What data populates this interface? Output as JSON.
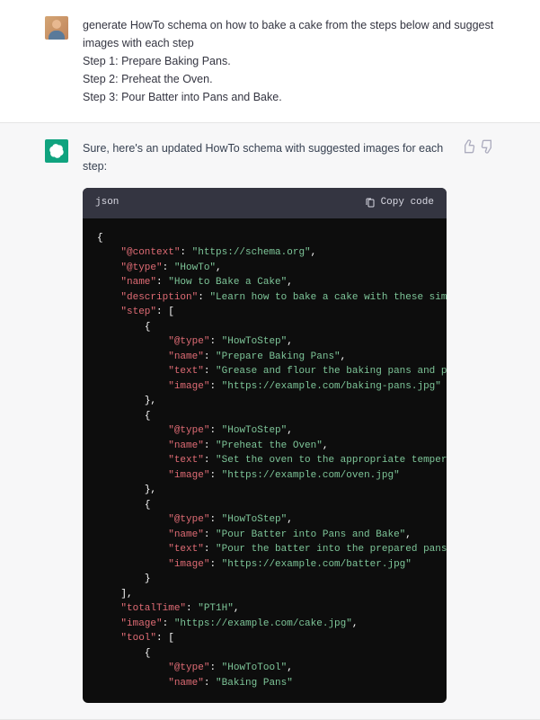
{
  "user": {
    "lines": [
      "generate HowTo schema on how to bake a cake from the steps below and suggest images with each step",
      "Step 1: Prepare Baking Pans.",
      "Step 2: Preheat the Oven.",
      "Step 3: Pour Batter into Pans and Bake."
    ]
  },
  "assistant": {
    "intro": "Sure, here's an updated HowTo schema with suggested images for each step:",
    "code_lang": "json",
    "copy_label": "Copy code"
  },
  "code": {
    "context_k": "\"@context\"",
    "context_v": "\"https://schema.org\"",
    "type_k": "\"@type\"",
    "howto_v": "\"HowTo\"",
    "name_k": "\"name\"",
    "name_v": "\"How to Bake a Cake\"",
    "desc_k": "\"description\"",
    "desc_v": "\"Learn how to bake a cake with these simple steps.\"",
    "step_k": "\"step\"",
    "howtostep_v": "\"HowToStep\"",
    "s1_name": "\"Prepare Baking Pans\"",
    "text_k": "\"text\"",
    "s1_text": "\"Grease and flour the baking pans and preheat the oven to the appropr",
    "image_k": "\"image\"",
    "s1_img": "\"https://example.com/baking-pans.jpg\"",
    "s2_name": "\"Preheat the Oven\"",
    "s2_text": "\"Set the oven to the appropriate temperature and let it preheat while",
    "s2_img": "\"https://example.com/oven.jpg\"",
    "s3_name": "\"Pour Batter into Pans and Bake\"",
    "s3_text": "\"Pour the batter into the prepared pans and bake for the appropriate ",
    "s3_img": "\"https://example.com/batter.jpg\"",
    "total_k": "\"totalTime\"",
    "total_v": "\"PT1H\"",
    "mainimg_v": "\"https://example.com/cake.jpg\"",
    "tool_k": "\"tool\"",
    "howtotool_v": "\"HowToTool\"",
    "t1_name": "\"Baking Pans\""
  }
}
